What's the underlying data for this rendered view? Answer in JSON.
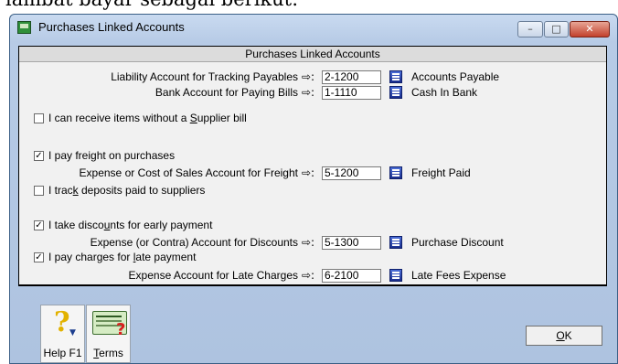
{
  "background_text": "lambat bayar sebagai berikut:",
  "window": {
    "title": "Purchases Linked Accounts",
    "controls": {
      "minimize": "–",
      "maximize": "□",
      "close": "✕"
    }
  },
  "panel": {
    "header": "Purchases Linked Accounts",
    "arrow_glyph": "⇨:",
    "rows": {
      "liability": {
        "label": "Liability Account for Tracking Payables",
        "account": "2-1200",
        "name": "Accounts Payable"
      },
      "bank": {
        "label": "Bank Account for Paying Bills",
        "account": "1-1110",
        "name": "Cash In Bank"
      },
      "freight": {
        "label": "Expense or Cost of Sales Account for Freight",
        "account": "5-1200",
        "name": "Freight Paid"
      },
      "discount": {
        "label": "Expense (or Contra) Account for Discounts",
        "account": "5-1300",
        "name": "Purchase Discount"
      },
      "late": {
        "label": "Expense Account for Late Charges",
        "account": "6-2100",
        "name": "Late Fees Expense"
      }
    },
    "checkboxes": {
      "no_supplier_bill": {
        "pre": "I can receive items without a ",
        "ul": "S",
        "post": "upplier bill",
        "checked": false
      },
      "pay_freight": {
        "pre": "I pay freight on purchases",
        "ul": "",
        "post": "",
        "checked": true
      },
      "track_deposits": {
        "pre": "I trac",
        "ul": "k",
        "post": " deposits paid to suppliers",
        "checked": false
      },
      "take_discounts": {
        "pre": "I take disco",
        "ul": "u",
        "post": "nts for early payment",
        "checked": true
      },
      "pay_late": {
        "pre": "I pay charges for ",
        "ul": "l",
        "post": "ate payment",
        "checked": true
      }
    },
    "check_mark": "✓"
  },
  "bottom_bar": {
    "help": {
      "label": "Help F1",
      "icon": "question-mark-icon"
    },
    "terms": {
      "ul": "T",
      "rest": "erms",
      "icon": "terms-card-icon"
    },
    "ok": {
      "ul": "O",
      "rest": "K"
    }
  },
  "colors": {
    "window_bg": "#b7cbe6",
    "panel_bg": "#f1f1f1",
    "close_red": "#c2412c"
  }
}
